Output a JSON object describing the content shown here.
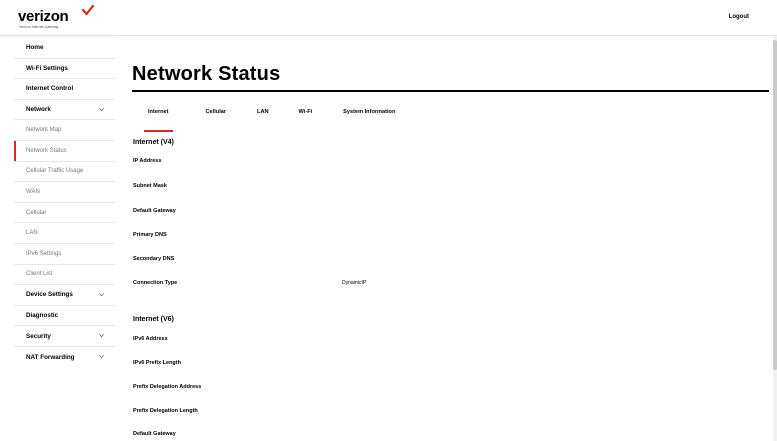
{
  "header": {
    "brand": "verizon",
    "brand_sub": "Verizon Internet Gateway",
    "logout_label": "Logout",
    "accent_color": "#d52b1e"
  },
  "sidebar": {
    "items": [
      {
        "label": "Home",
        "level": "top"
      },
      {
        "label": "Wi-Fi Settings",
        "level": "top"
      },
      {
        "label": "Internet Control",
        "level": "top"
      },
      {
        "label": "Network",
        "level": "top",
        "expandable": true
      },
      {
        "label": "Network Map",
        "level": "sub"
      },
      {
        "label": "Network Status",
        "level": "sub",
        "active": true
      },
      {
        "label": "Cellular Traffic Usage",
        "level": "sub"
      },
      {
        "label": "WAN",
        "level": "sub"
      },
      {
        "label": "Cellular",
        "level": "sub"
      },
      {
        "label": "LAN",
        "level": "sub"
      },
      {
        "label": "IPv6 Settings",
        "level": "sub"
      },
      {
        "label": "Client List",
        "level": "sub"
      },
      {
        "label": "Device Settings",
        "level": "top",
        "expandable": true
      },
      {
        "label": "Diagnostic",
        "level": "top"
      },
      {
        "label": "Security",
        "level": "top",
        "expandable": true
      },
      {
        "label": "NAT Forwarding",
        "level": "top",
        "expandable": true
      }
    ]
  },
  "main": {
    "title": "Network Status",
    "tabs": [
      {
        "label": "Internet",
        "active": true
      },
      {
        "label": "Cellular"
      },
      {
        "label": "LAN"
      },
      {
        "label": "Wi-Fi"
      },
      {
        "label": "System Information"
      }
    ],
    "sections": [
      {
        "title": "Internet (V4)",
        "rows": [
          {
            "label": "IP Address",
            "value": ""
          },
          {
            "label": "Subnet Mask",
            "value": ""
          },
          {
            "label": "Default Gateway",
            "value": ""
          },
          {
            "label": "Primary DNS",
            "value": ""
          },
          {
            "label": "Secondary DNS",
            "value": ""
          },
          {
            "label": "Connection Type",
            "value": "DynamicIP"
          }
        ]
      },
      {
        "title": "Internet (V6)",
        "rows": [
          {
            "label": "IPv6 Address",
            "value": ""
          },
          {
            "label": "IPv6 Prefix Length",
            "value": ""
          },
          {
            "label": "Prefix Delegation Address",
            "value": ""
          },
          {
            "label": "Prefix Delegation Length",
            "value": ""
          },
          {
            "label": "Default Gateway",
            "value": ""
          }
        ]
      }
    ]
  }
}
